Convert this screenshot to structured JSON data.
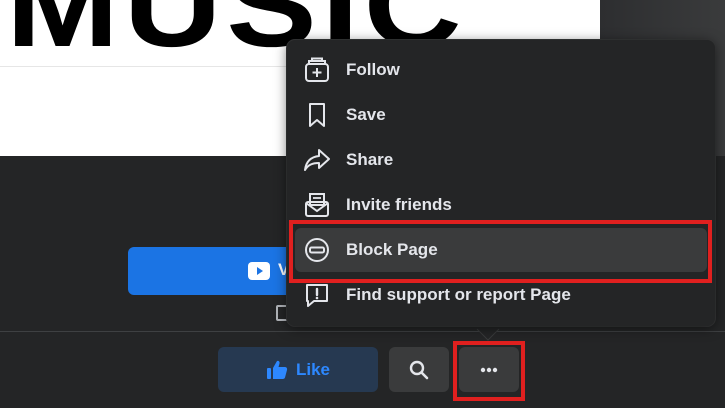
{
  "cover": {
    "text": "MUSIC"
  },
  "profile": {
    "cta_label": "V"
  },
  "actions": {
    "like_label": "Like"
  },
  "menu": {
    "items": [
      {
        "label": "Follow",
        "icon": "follow-icon"
      },
      {
        "label": "Save",
        "icon": "bookmark-icon"
      },
      {
        "label": "Share",
        "icon": "share-icon"
      },
      {
        "label": "Invite friends",
        "icon": "invite-icon"
      },
      {
        "label": "Block Page",
        "icon": "block-icon",
        "highlighted": true
      },
      {
        "label": "Find support or report Page",
        "icon": "report-icon"
      }
    ]
  },
  "colors": {
    "highlight": "#e0201f",
    "accent": "#2d88ff",
    "cta": "#1b74e4"
  }
}
